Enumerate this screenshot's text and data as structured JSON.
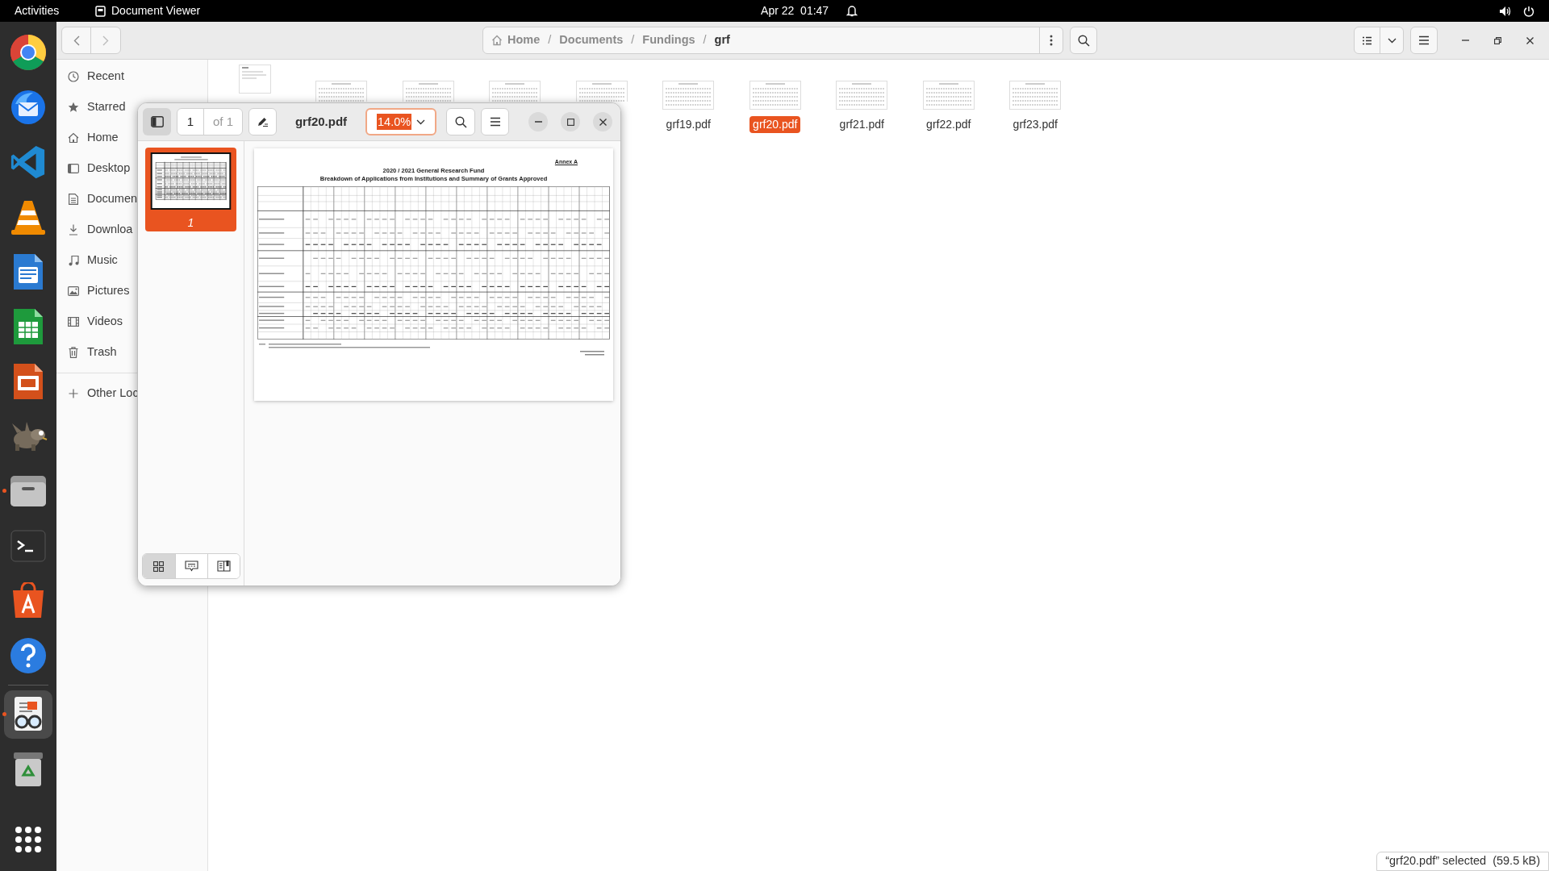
{
  "top_bar": {
    "activities": "Activities",
    "app_name": "Document Viewer",
    "clock": "Apr 22  01:47"
  },
  "dock": [
    {
      "kind": "browser",
      "running": false,
      "selected": false
    },
    {
      "kind": "mail",
      "running": false,
      "selected": false
    },
    {
      "kind": "code",
      "running": false,
      "selected": false
    },
    {
      "kind": "cone",
      "running": false,
      "selected": false
    },
    {
      "kind": "writer",
      "running": false,
      "selected": false
    },
    {
      "kind": "calc",
      "running": false,
      "selected": false
    },
    {
      "kind": "impress",
      "running": false,
      "selected": false
    },
    {
      "kind": "mascot",
      "running": false,
      "selected": false
    },
    {
      "kind": "files",
      "running": true,
      "selected": false
    },
    {
      "kind": "terminal",
      "running": false,
      "selected": false
    },
    {
      "kind": "store",
      "running": false,
      "selected": false
    },
    {
      "kind": "help",
      "running": false,
      "selected": false
    },
    {
      "kind": "separator"
    },
    {
      "kind": "viewer",
      "running": true,
      "selected": true
    },
    {
      "kind": "trash",
      "running": false,
      "selected": false
    }
  ],
  "files_window": {
    "path": [
      "Home",
      "Documents",
      "Fundings",
      "grf"
    ],
    "path_separator": "/",
    "sidebar": [
      {
        "kind": "recent",
        "label": "Recent"
      },
      {
        "kind": "starred",
        "label": "Starred"
      },
      {
        "kind": "home",
        "label": "Home"
      },
      {
        "kind": "desktop",
        "label": "Desktop"
      },
      {
        "kind": "documents",
        "label": "Documen"
      },
      {
        "kind": "downloads",
        "label": "Downloa"
      },
      {
        "kind": "music",
        "label": "Music"
      },
      {
        "kind": "pictures",
        "label": "Pictures"
      },
      {
        "kind": "videos",
        "label": "Videos"
      },
      {
        "kind": "trash",
        "label": "Trash"
      },
      {
        "kind": "divider"
      },
      {
        "kind": "other",
        "label": "Other Loc"
      }
    ],
    "files": [
      {
        "kind": "portrait"
      },
      {
        "kind": "landscape_top"
      },
      {
        "kind": "landscape_top"
      },
      {
        "kind": "landscape_top"
      },
      {
        "kind": "landscape_top"
      },
      {
        "kind": "landscape",
        "label": "grf19.pdf",
        "selected": false
      },
      {
        "kind": "landscape",
        "label": "grf20.pdf",
        "selected": true
      },
      {
        "kind": "landscape",
        "label": "grf21.pdf",
        "selected": false
      },
      {
        "kind": "landscape",
        "label": "grf22.pdf",
        "selected": false
      },
      {
        "kind": "landscape",
        "label": "grf23.pdf",
        "selected": false
      }
    ],
    "status": "“grf20.pdf” selected  (59.5 kB)"
  },
  "viewer": {
    "title": "grf20.pdf",
    "page": "1",
    "page_count": "of 1",
    "zoom": "14.0%",
    "sidebar_open": true,
    "thumbnails": [
      {
        "label": "1",
        "selected": true
      }
    ],
    "sidebar_modes": [
      {
        "kind": "thumbnails",
        "selected": true
      },
      {
        "kind": "annotations",
        "selected": false
      },
      {
        "kind": "bookmarks",
        "selected": false
      }
    ],
    "document": {
      "annex": "Annex A",
      "title": "2020 / 2021 General Research Fund",
      "subtitle": "Breakdown of Applications from Institutions and Summary of Grants Approved"
    }
  }
}
